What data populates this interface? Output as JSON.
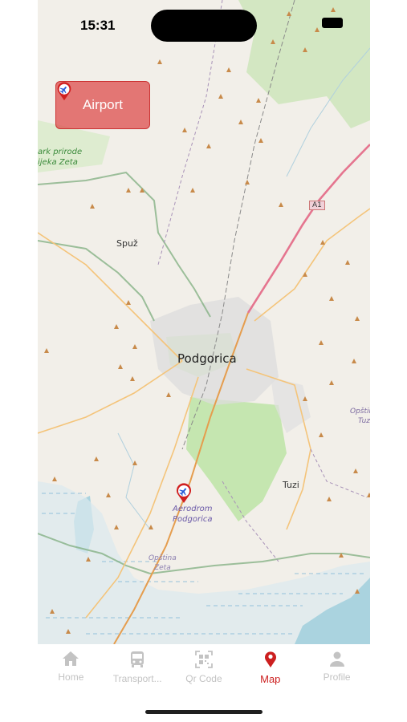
{
  "status_bar": {
    "time": "15:31"
  },
  "airport_button": {
    "label": "Airport"
  },
  "map_labels": {
    "park_line1": "ark prirode",
    "park_line2": "ijeka Zeta",
    "spuz": "Spuž",
    "podgorica": "Podgorica",
    "a1": "A1",
    "opstina_tuzi_1": "Opština",
    "opstina_tuzi_2": "Tuz",
    "tuzi": "Tuzi",
    "aerodrom_1": "Aerodrom",
    "aerodrom_2": "Podgorica",
    "opstina_zeta_1": "Opština",
    "opstina_zeta_2": "Zeta"
  },
  "tabs": [
    {
      "label": "Home",
      "icon": "home-icon",
      "active": false
    },
    {
      "label": "Transport...",
      "icon": "bus-icon",
      "active": false
    },
    {
      "label": "Qr Code",
      "icon": "qr-code-icon",
      "active": false
    },
    {
      "label": "Map",
      "icon": "map-pin-icon",
      "active": true
    },
    {
      "label": "Profile",
      "icon": "person-icon",
      "active": false
    }
  ],
  "colors": {
    "accent": "#cc1f1f",
    "inactive": "#c3c3c3",
    "map_bg": "#f2efe9"
  }
}
